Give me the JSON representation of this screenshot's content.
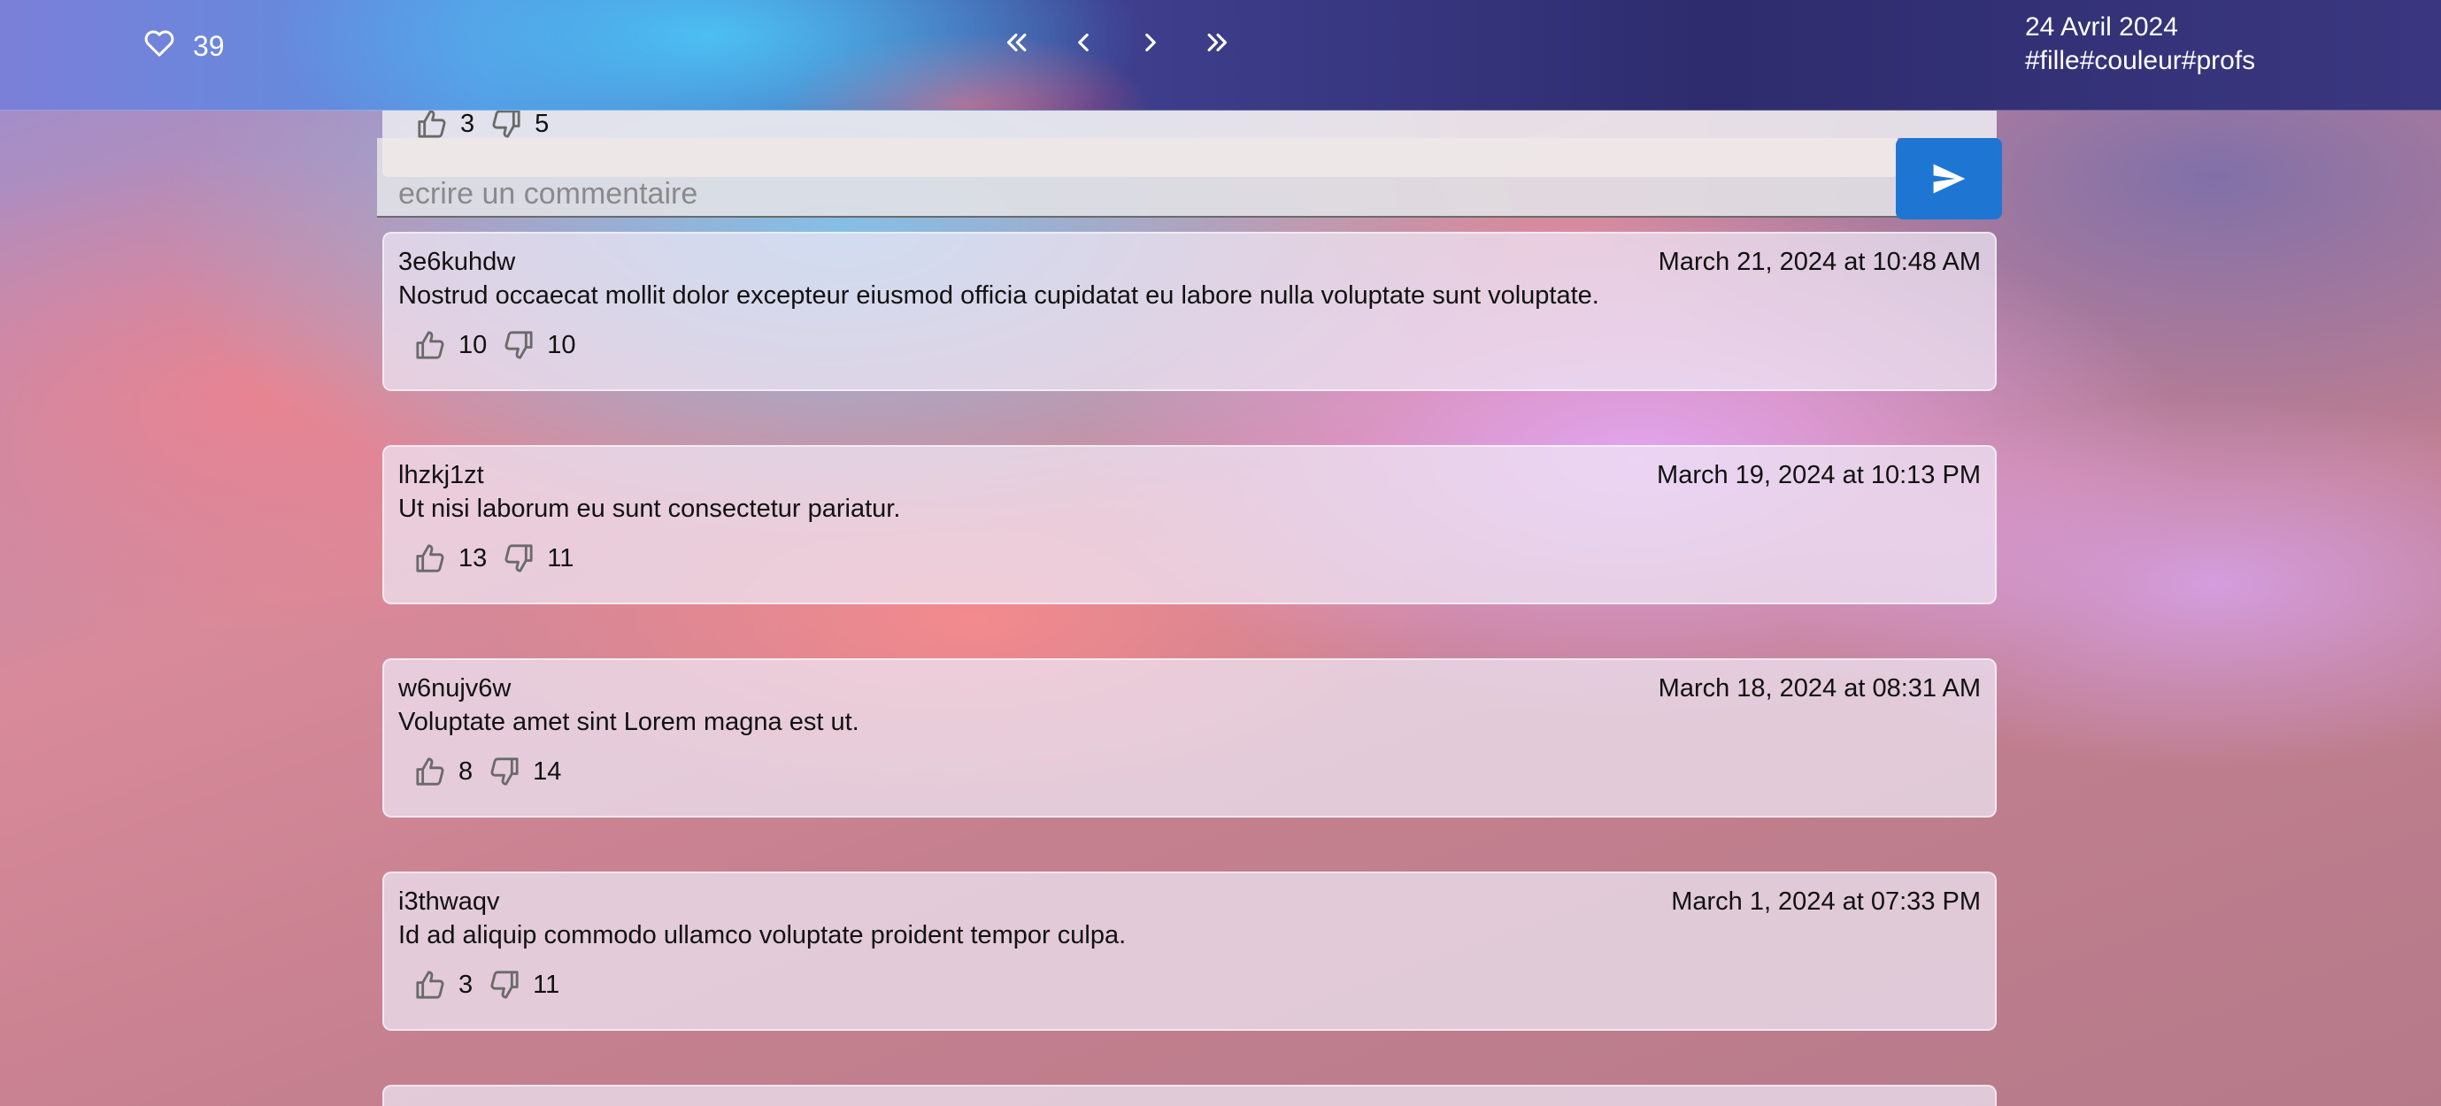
{
  "header": {
    "likes_count": "39",
    "date": "24 Avril 2024",
    "tags": "#fille#couleur#profs"
  },
  "icons": {
    "like": "heart-icon",
    "first": "double-chevron-left-icon",
    "prev": "chevron-left-icon",
    "next": "chevron-right-icon",
    "last": "double-chevron-right-icon",
    "thumbs_up": "thumbs-up-icon",
    "thumbs_down": "thumbs-down-icon",
    "send": "send-icon"
  },
  "colors": {
    "send_button": "#1f76d2",
    "icon_gray": "#6a6a6a"
  },
  "composer": {
    "prev_up": "3",
    "prev_down": "5",
    "placeholder": "ecrire un commentaire"
  },
  "comments": [
    {
      "author": "3e6kuhdw",
      "date": "March 21, 2024 at 10:48 AM",
      "text": "Nostrud occaecat mollit dolor excepteur eiusmod officia cupidatat eu labore nulla voluptate sunt voluptate.",
      "up": "10",
      "down": "10"
    },
    {
      "author": "lhzkj1zt",
      "date": "March 19, 2024 at 10:13 PM",
      "text": "Ut nisi laborum eu sunt consectetur pariatur.",
      "up": "13",
      "down": "11"
    },
    {
      "author": "w6nujv6w",
      "date": "March 18, 2024 at 08:31 AM",
      "text": "Voluptate amet sint Lorem magna est ut.",
      "up": "8",
      "down": "14"
    },
    {
      "author": "i3thwaqv",
      "date": "March 1, 2024 at 07:33 PM",
      "text": "Id ad aliquip commodo ullamco voluptate proident tempor culpa.",
      "up": "3",
      "down": "11"
    }
  ]
}
